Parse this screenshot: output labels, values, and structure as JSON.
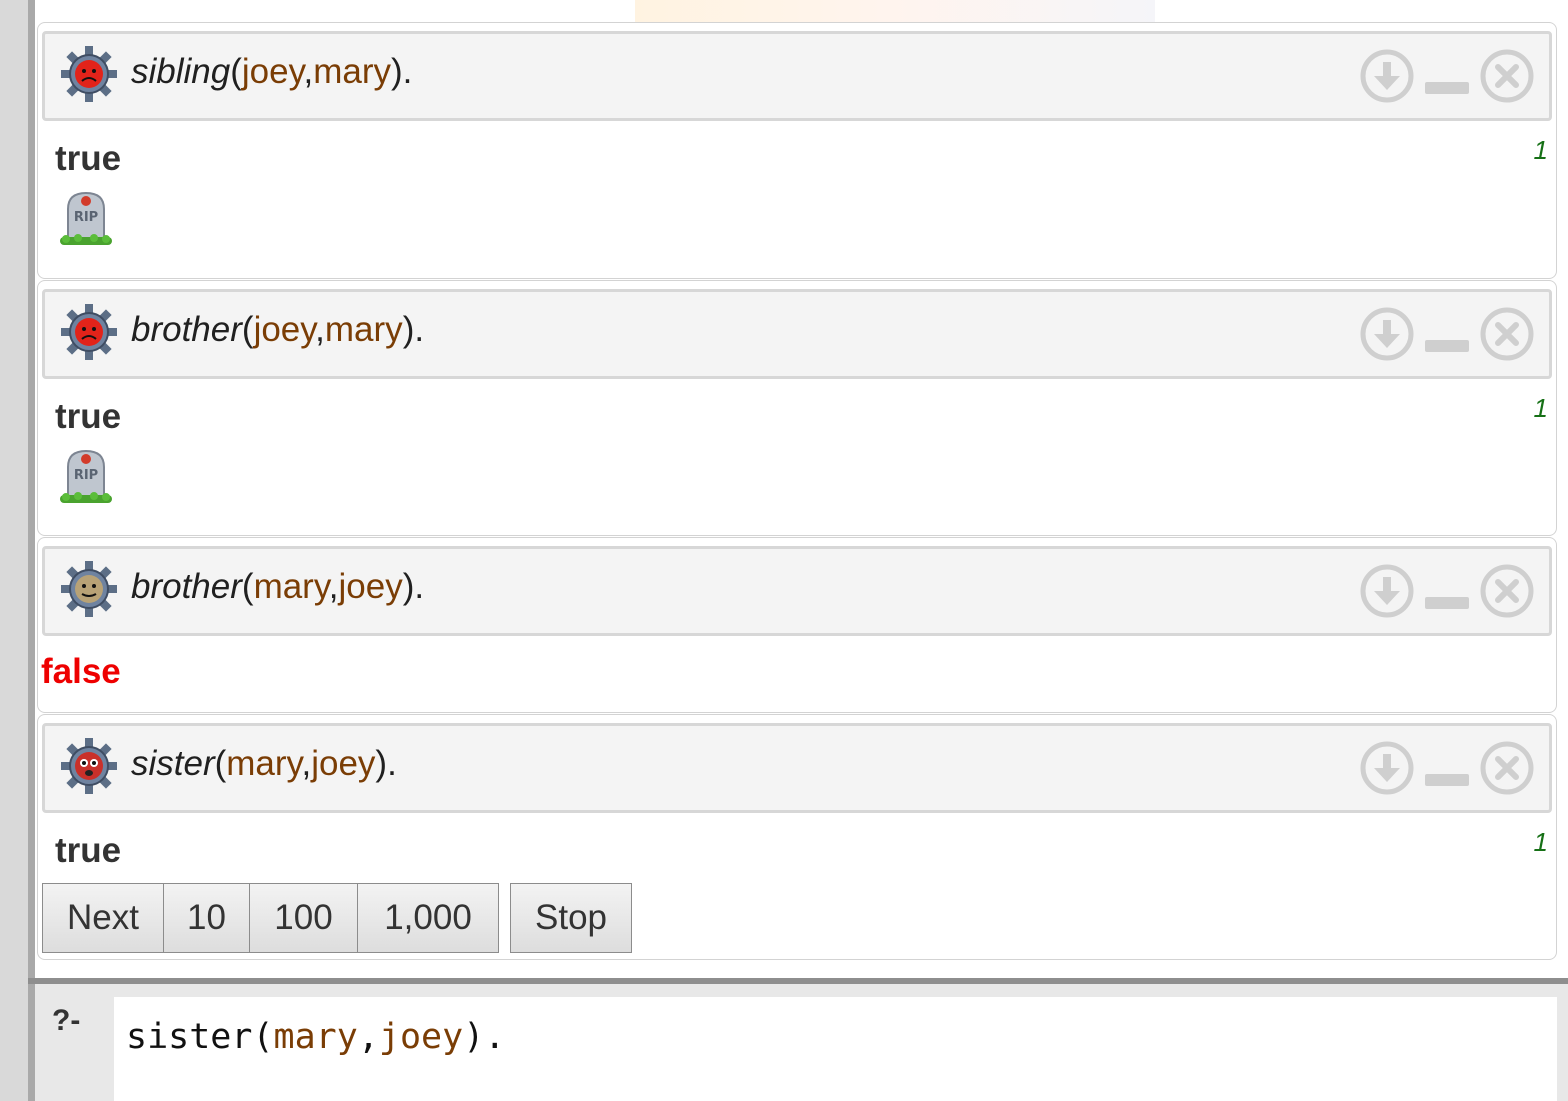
{
  "queries": [
    {
      "predicate": "sibling",
      "args_open": "(",
      "arg1": "joey",
      "sep": ",",
      "arg2": "mary",
      "args_close": ").",
      "status_icon": "red-sad-face-gear-icon",
      "answer": "true",
      "answer_count": "1",
      "result_icon": "rip-tombstone-icon"
    },
    {
      "predicate": "brother",
      "args_open": "(",
      "arg1": "joey",
      "sep": ",",
      "arg2": "mary",
      "args_close": ").",
      "status_icon": "red-sad-face-gear-icon",
      "answer": "true",
      "answer_count": "1",
      "result_icon": "rip-tombstone-icon"
    },
    {
      "predicate": "brother",
      "args_open": "(",
      "arg1": "mary",
      "sep": ",",
      "arg2": "joey",
      "args_close": ").",
      "status_icon": "neutral-face-gear-icon",
      "answer": "false"
    },
    {
      "predicate": "sister",
      "args_open": "(",
      "arg1": "mary",
      "sep": ",",
      "arg2": "joey",
      "args_close": ").",
      "status_icon": "running-face-gear-icon",
      "answer": "true",
      "answer_count": "1",
      "buttons": [
        "Next",
        "10",
        "100",
        "1,000"
      ],
      "stop_label": "Stop"
    }
  ],
  "controls": {
    "download_icon": "download-icon",
    "minimize_icon": "minimize-icon",
    "close_icon": "close-icon"
  },
  "editor": {
    "prompt": "?-",
    "predicate": "sister",
    "open": "(",
    "arg1": "mary",
    "sep": ",",
    "arg2": "joey",
    "close": ")."
  },
  "colors": {
    "arg": "#7a3d05",
    "false": "#ee0000",
    "count": "#167016"
  }
}
